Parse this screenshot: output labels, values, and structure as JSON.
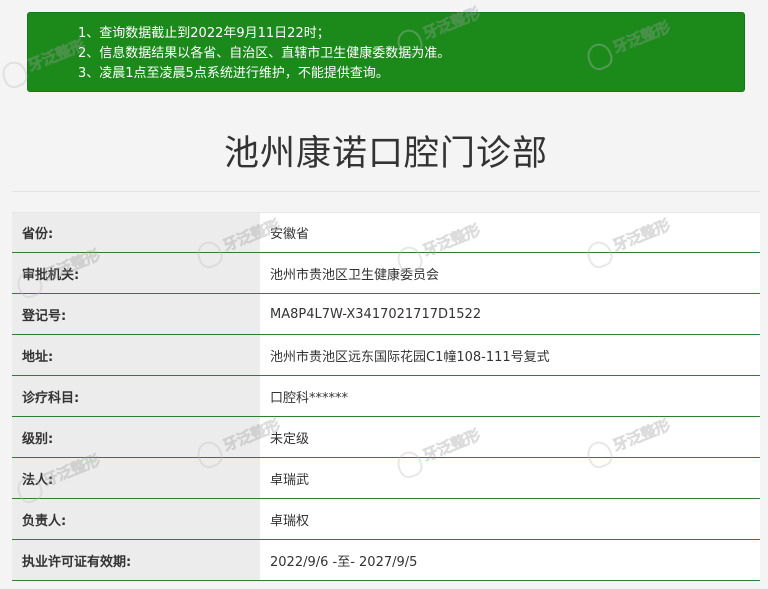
{
  "notice": {
    "lines": [
      "1、查询数据截止到2022年9月11日22时；",
      "2、信息数据结果以各省、自治区、直辖市卫生健康委数据为准。",
      "3、凌晨1点至凌晨5点系统进行维护，不能提供查询。"
    ],
    "background_color": "#1b8a1b"
  },
  "page": {
    "title": "池州康诺口腔门诊部"
  },
  "table": {
    "border_color": "#2e7d32",
    "rows": [
      {
        "label": "省份:",
        "value": "安徽省"
      },
      {
        "label": "审批机关:",
        "value": "池州市贵池区卫生健康委员会"
      },
      {
        "label": "登记号:",
        "value": "MA8P4L7W-X3417021717D1522"
      },
      {
        "label": "地址:",
        "value": "池州市贵池区远东国际花园C1幢108-111号复式"
      },
      {
        "label": "诊疗科目:",
        "value": "口腔科******"
      },
      {
        "label": "级别:",
        "value": "未定级"
      },
      {
        "label": "法人:",
        "value": "卓瑞武"
      },
      {
        "label": "负责人:",
        "value": "卓瑞权"
      },
      {
        "label": "执业许可证有效期:",
        "value": "2022/9/6 -至- 2027/9/5"
      }
    ]
  },
  "watermark": {
    "text": "牙泛整形"
  }
}
